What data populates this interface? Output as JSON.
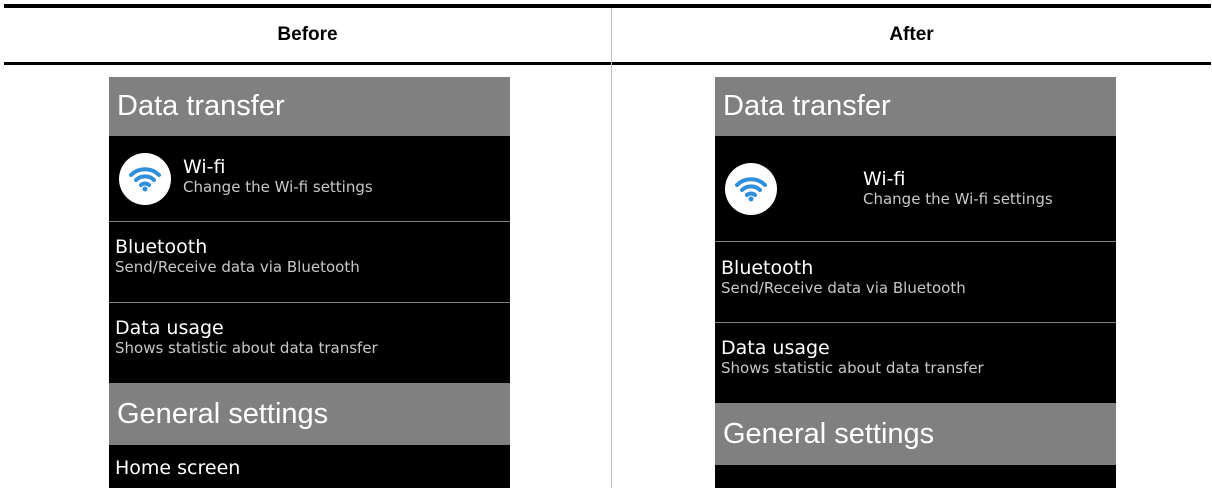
{
  "columns": {
    "before_label": "Before",
    "after_label": "After"
  },
  "screen": {
    "section1": "Data transfer",
    "wifi": {
      "title": "Wi-fi",
      "subtitle": "Change the Wi-fi settings",
      "icon": "wifi-icon"
    },
    "bluetooth": {
      "title": "Bluetooth",
      "subtitle": "Send/Receive data via Bluetooth"
    },
    "data_usage": {
      "title": "Data usage",
      "subtitle": "Shows statistic about data transfer"
    },
    "section2": "General settings",
    "home": {
      "title": "Home screen"
    }
  },
  "colors": {
    "header_bg": "#808080",
    "screen_bg": "#000000",
    "wifi_blue": "#2f8fdc"
  }
}
